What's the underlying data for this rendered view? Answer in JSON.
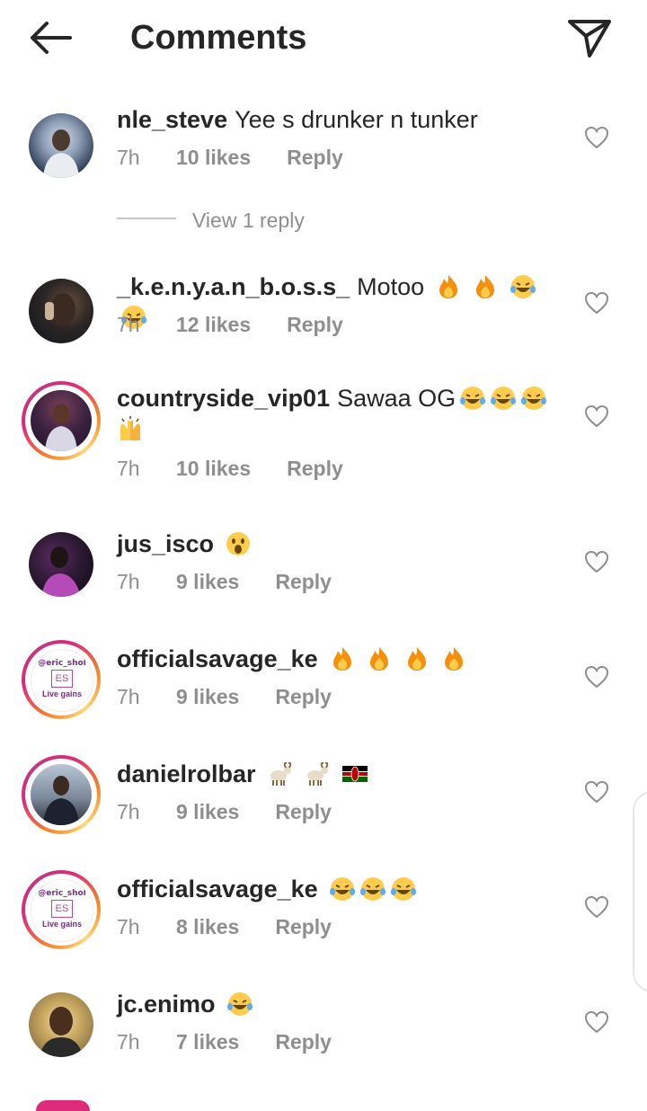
{
  "header": {
    "title": "Comments",
    "back_icon": "arrow-left-icon",
    "send_icon": "send-icon"
  },
  "comments": [
    {
      "username": "nle_steve",
      "text": "Yee s drunker n tunker",
      "time": "7h",
      "likes": "10 likes",
      "reply": "Reply",
      "has_story": false,
      "view_replies": "View 1 reply"
    },
    {
      "username": "_k.e.n.y.a.n_b.o.s.s_",
      "text": "Motoo",
      "emojis": [
        "fire",
        "fire",
        "laugh",
        "laugh"
      ],
      "time": "7h",
      "likes": "12 likes",
      "reply": "Reply",
      "has_story": false
    },
    {
      "username": "countryside_vip01",
      "text": "Sawaa OG",
      "emojis": [
        "laugh",
        "laugh",
        "laugh",
        "raised-hands"
      ],
      "time": "7h",
      "likes": "10 likes",
      "reply": "Reply",
      "has_story": true
    },
    {
      "username": "jus_isco",
      "text": "",
      "emojis": [
        "surprised"
      ],
      "time": "7h",
      "likes": "9 likes",
      "reply": "Reply",
      "has_story": false
    },
    {
      "username": "officialsavage_ke",
      "text": "",
      "emojis": [
        "fire",
        "fire",
        "fire",
        "fire"
      ],
      "time": "7h",
      "likes": "9 likes",
      "reply": "Reply",
      "has_story": true,
      "avatar_text": {
        "handle": "@eric_shol",
        "mark": "ES",
        "tag": "Live gains"
      }
    },
    {
      "username": "danielrolbar",
      "text": "",
      "emojis": [
        "goat",
        "goat",
        "kenya-flag"
      ],
      "time": "7h",
      "likes": "9 likes",
      "reply": "Reply",
      "has_story": true
    },
    {
      "username": "officialsavage_ke",
      "text": "",
      "emojis": [
        "laugh",
        "laugh",
        "laugh"
      ],
      "time": "7h",
      "likes": "8 likes",
      "reply": "Reply",
      "has_story": true,
      "avatar_text": {
        "handle": "@eric_shol",
        "mark": "ES",
        "tag": "Live gains"
      }
    },
    {
      "username": "jc.enimo",
      "text": "",
      "emojis": [
        "laugh"
      ],
      "time": "7h",
      "likes": "7 likes",
      "reply": "Reply",
      "has_story": false
    }
  ],
  "colors": {
    "text": "#262626",
    "secondary": "#8e8e8e",
    "story_ring": [
      "#f58529",
      "#dd2a7b",
      "#c13584"
    ]
  }
}
